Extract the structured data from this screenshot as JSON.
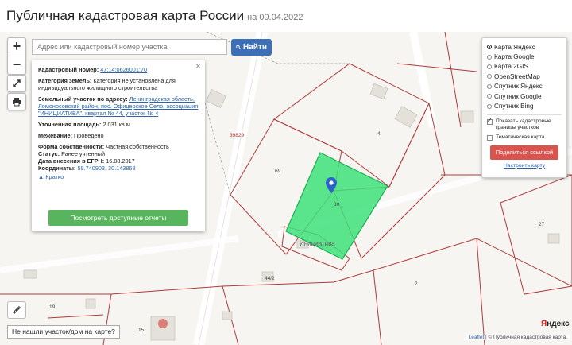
{
  "header": {
    "title": "Публичная кадастровая карта России",
    "date": "на 09.04.2022"
  },
  "search": {
    "placeholder": "Адрес или кадастровый номер участка",
    "button_label": "Найти"
  },
  "info_card": {
    "cadastral_label": "Кадастровый номер:",
    "cadastral_number": "47:14:0626001:70",
    "category_label": "Категория земель:",
    "category_value": "Категория не установлена для индивидуального жилищного строительства",
    "address_label": "Земельный участок по адресу:",
    "address_value": "Ленинградская область, Ломоносовский район, пос. Офицерское Село, ассоциация \"ИНИЦИАТИВА\", квартал № 44, участок № 4",
    "area_label": "Уточненная площадь:",
    "area_value": "2 031 кв.м.",
    "survey_label": "Межевание:",
    "survey_value": "Проведено",
    "ownership_label": "Форма собственности:",
    "ownership_value": "Частная собственность",
    "status_label": "Статус:",
    "status_value": "Ранее учтенный",
    "egrn_label": "Дата внесения в ЕГРН:",
    "egrn_value": "16.08.2017",
    "coords_label": "Координаты:",
    "coords_value": "59.740903, 30.143868",
    "brief_label": "Кратко",
    "reports_button": "Посмотреть доступные отчеты"
  },
  "layers": {
    "options": [
      "Карта Яндекс",
      "Карта Google",
      "Карта 2GIS",
      "OpenStreetMap",
      "Спутник Яндекс",
      "Спутник Google",
      "Спутник Bing"
    ],
    "selected": 0,
    "show_borders": "Показать кадастровые границы участков",
    "thematic": "Тематическая карта",
    "share_button": "Поделиться ссылкой",
    "configure": "Настроить карту"
  },
  "map_labels": {
    "p39829": "39829",
    "p4": "4",
    "p69": "69",
    "p30": "30",
    "p27": "27",
    "p442": "44/2",
    "p2": "2",
    "p19": "19",
    "p15": "15",
    "street": "Инициатива"
  },
  "footer": {
    "not_found": "Не нашли участок/дом на карте?",
    "leaflet": "Leaflet",
    "attribution": "| © Публичная кадастровая карта.",
    "brand_y": "Я",
    "brand_rest": "ндекс"
  },
  "colors": {
    "parcel_fill": "#3ee07a",
    "border": "#b03a3a",
    "search_button": "#3d6fb6",
    "report_button": "#59b45e",
    "share_button": "#d9534f"
  },
  "icons": {
    "zoom_in": "plus-icon",
    "zoom_out": "minus-icon",
    "fullscreen": "expand-icon",
    "print": "printer-icon",
    "ruler": "ruler-icon",
    "marker": "location-pin-icon",
    "search": "search-icon",
    "close": "close-icon"
  }
}
